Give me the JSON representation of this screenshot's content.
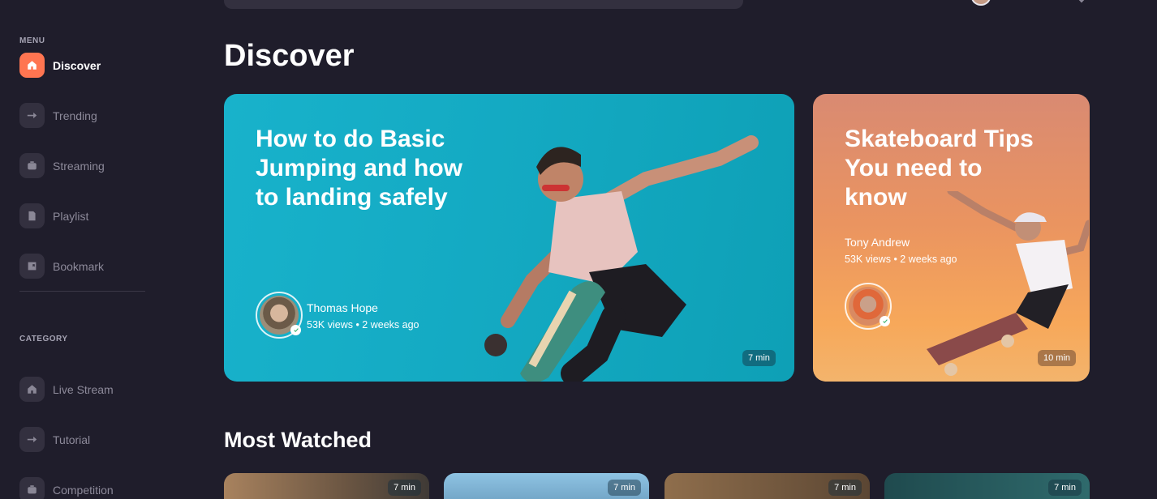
{
  "sidebar": {
    "menu_label": "MENU",
    "menu_items": [
      {
        "label": "Discover",
        "icon": "home-icon",
        "active": true
      },
      {
        "label": "Trending",
        "icon": "arrow-right-icon",
        "active": false
      },
      {
        "label": "Streaming",
        "icon": "video-icon",
        "active": false
      },
      {
        "label": "Playlist",
        "icon": "playlist-icon",
        "active": false
      },
      {
        "label": "Bookmark",
        "icon": "bookmark-icon",
        "active": false
      }
    ],
    "category_label": "CATEGORY",
    "category_items": [
      {
        "label": "Live Stream",
        "icon": "home-icon"
      },
      {
        "label": "Tutorial",
        "icon": "arrow-right-icon"
      },
      {
        "label": "Competition",
        "icon": "video-icon"
      }
    ]
  },
  "main": {
    "title": "Discover",
    "featured": [
      {
        "title": "How to do Basic Jumping and how to landing safely",
        "author": "Thomas Hope",
        "meta": "53K views • 2 weeks ago",
        "duration": "7 min"
      },
      {
        "title": "Skateboard Tips You need to know",
        "author": "Tony Andrew",
        "meta": "53K views • 2 weeks ago",
        "duration": "10 min"
      }
    ],
    "most_watched_title": "Most Watched",
    "most_watched": [
      {
        "duration": "7 min"
      },
      {
        "duration": "7 min"
      },
      {
        "duration": "7 min"
      },
      {
        "duration": "7 min"
      }
    ]
  },
  "colors": {
    "background": "#1f1d2b",
    "accent": "#ff7551",
    "card_primary": "#14aac3",
    "card_secondary": "#ea9460"
  }
}
